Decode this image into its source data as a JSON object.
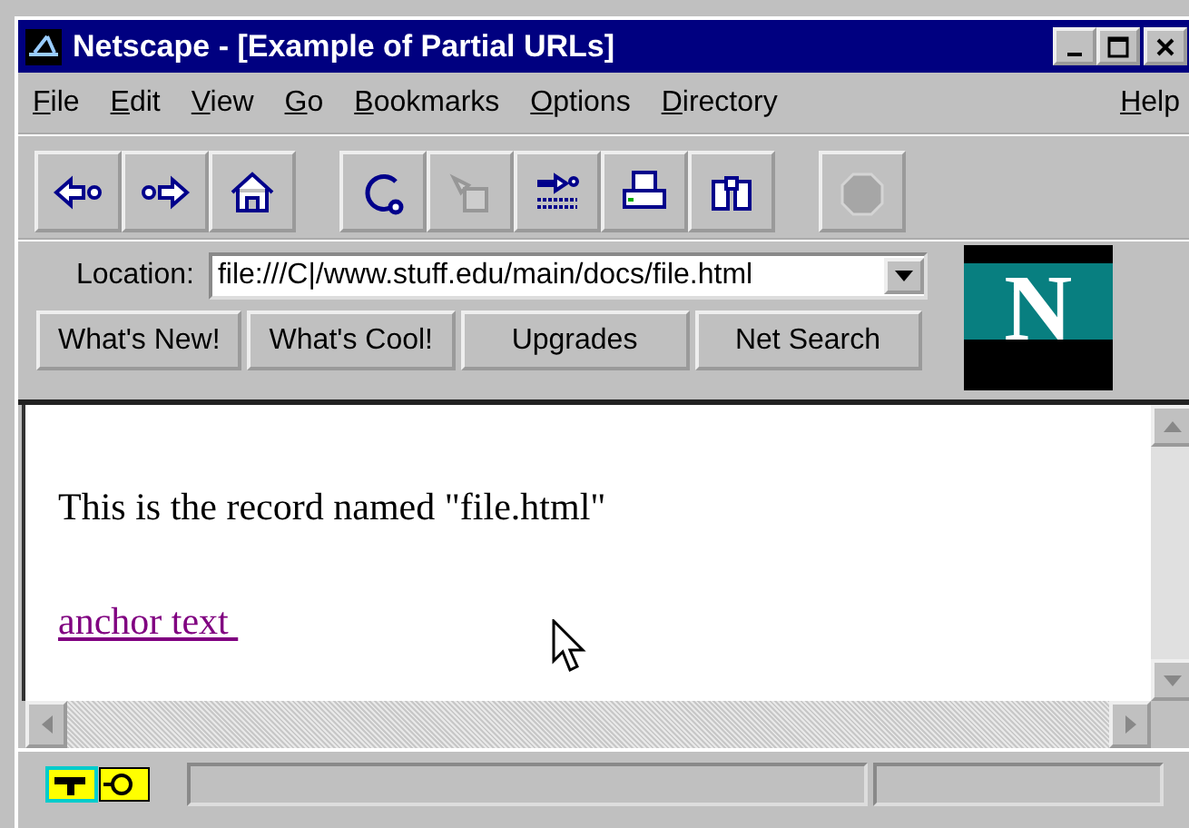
{
  "window": {
    "title": "Netscape - [Example of Partial URLs]",
    "controls": [
      {
        "kind": "minimize"
      },
      {
        "kind": "maximize"
      },
      {
        "kind": "close"
      }
    ]
  },
  "menu": [
    {
      "label": "File"
    },
    {
      "label": "Edit"
    },
    {
      "label": "View"
    },
    {
      "label": "Go"
    },
    {
      "label": "Bookmarks"
    },
    {
      "label": "Options"
    },
    {
      "label": "Directory"
    },
    {
      "label": "Help",
      "kind": "right"
    }
  ],
  "toolbar": [
    {
      "kind": "back",
      "disabled": false
    },
    {
      "kind": "forward",
      "disabled": false
    },
    {
      "kind": "home",
      "disabled": false
    },
    {
      "kind": "separator"
    },
    {
      "kind": "reload",
      "disabled": false
    },
    {
      "kind": "images",
      "disabled": true
    },
    {
      "kind": "open",
      "disabled": false
    },
    {
      "kind": "print",
      "disabled": false
    },
    {
      "kind": "find",
      "disabled": false
    },
    {
      "kind": "separator"
    },
    {
      "kind": "stop",
      "disabled": true
    }
  ],
  "location": {
    "label": "Location:",
    "value": "file:///C|/www.stuff.edu/main/docs/file.html"
  },
  "directory_buttons": [
    "What's New!",
    "What's Cool!",
    "Upgrades",
    "Net Search"
  ],
  "logo": {
    "letter": "N"
  },
  "content": {
    "paragraph": "This is the record named \"file.html\"",
    "link": "anchor text "
  }
}
